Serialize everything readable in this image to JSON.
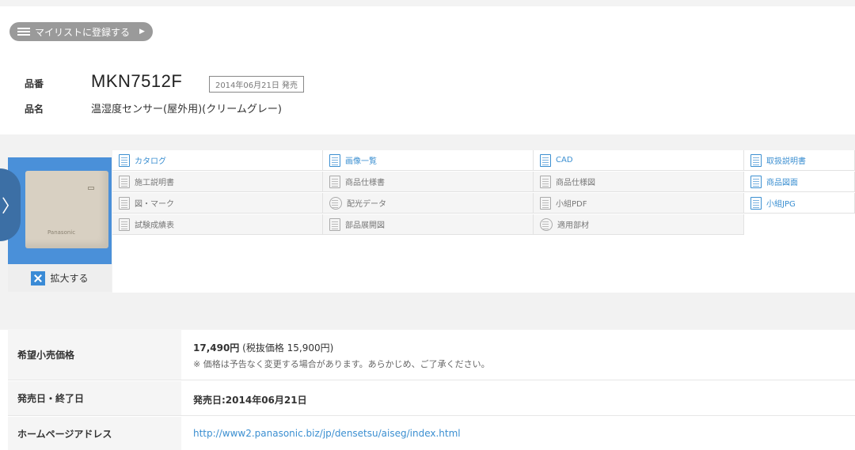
{
  "mylist_button": {
    "label": "マイリストに登録する"
  },
  "product": {
    "number_label": "品番",
    "number": "MKN7512F",
    "release_badge": "2014年06月21日 発売",
    "name_label": "品名",
    "name": "温湿度センサー(屋外用)(クリームグレー)"
  },
  "photo": {
    "brand": "Panasonic",
    "zoom_label": "拡大する"
  },
  "documents": {
    "col1": [
      "カタログ",
      "施工説明書",
      "図・マーク",
      "試験成績表"
    ],
    "col2": [
      "画像一覧",
      "商品仕様書",
      "配光データ",
      "部品展開図"
    ],
    "col3": [
      "CAD",
      "商品仕様図",
      "小組PDF",
      "適用部材"
    ],
    "col4": [
      "取扱説明書",
      "商品図面",
      "小組JPG"
    ]
  },
  "specs": {
    "price_label": "希望小売価格",
    "price_value": "17,490円",
    "price_tax": "(税抜価格 15,900円)",
    "price_note": "※ 価格は予告なく変更する場合があります。あらかじめ、ご了承ください。",
    "date_label": "発売日・終了日",
    "date_value": "発売日:2014年06月21日",
    "homepage_label": "ホームページアドレス",
    "homepage_url": "http://www2.panasonic.biz/jp/densetsu/aiseg/index.html"
  }
}
